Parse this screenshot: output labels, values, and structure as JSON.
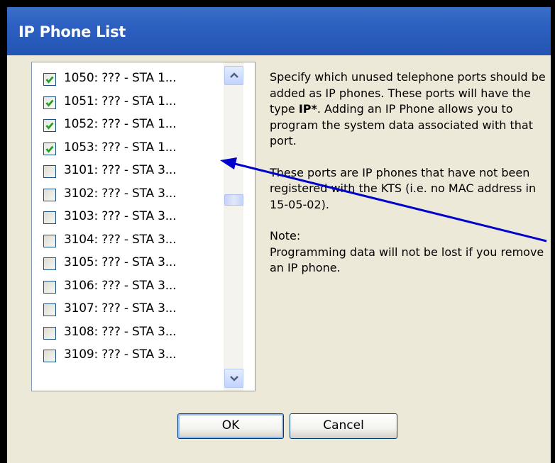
{
  "window": {
    "title": "IP Phone List"
  },
  "list": {
    "items": [
      {
        "label": "1050: ??? - STA 1...",
        "checked": true
      },
      {
        "label": "1051: ??? - STA 1...",
        "checked": true
      },
      {
        "label": "1052: ??? - STA 1...",
        "checked": true
      },
      {
        "label": "1053: ??? - STA 1...",
        "checked": true
      },
      {
        "label": "3101: ??? - STA 3...",
        "checked": false
      },
      {
        "label": "3102: ??? - STA 3...",
        "checked": false
      },
      {
        "label": "3103: ??? - STA 3...",
        "checked": false
      },
      {
        "label": "3104: ??? - STA 3...",
        "checked": false
      },
      {
        "label": "3105: ??? - STA 3...",
        "checked": false
      },
      {
        "label": "3106: ??? - STA 3...",
        "checked": false
      },
      {
        "label": "3107: ??? - STA 3...",
        "checked": false
      },
      {
        "label": "3108: ??? - STA 3...",
        "checked": false
      },
      {
        "label": "3109: ??? - STA 3...",
        "checked": false
      }
    ]
  },
  "description": {
    "p1_before": "Specify which unused telephone ports should be added as IP phones. These ports will have the type ",
    "p1_bold": "IP*",
    "p1_after": ". Adding an IP Phone allows you to program the system data associated with that port.",
    "p2": "These ports are IP phones that have not been registered with the KTS (i.e. no MAC address in 15-05-02).",
    "note_heading": "Note:",
    "note_text": "Programming data will not be lost if you remove an IP phone."
  },
  "buttons": {
    "ok": "OK",
    "cancel": "Cancel"
  },
  "icons": {
    "checkmark": "checkmark-icon",
    "scroll_up": "chevron-up-icon",
    "scroll_down": "chevron-down-icon"
  },
  "colors": {
    "titlebar": "#2c5fbf",
    "checkmark": "#21a121",
    "annotation_arrow": "#0000cc"
  }
}
